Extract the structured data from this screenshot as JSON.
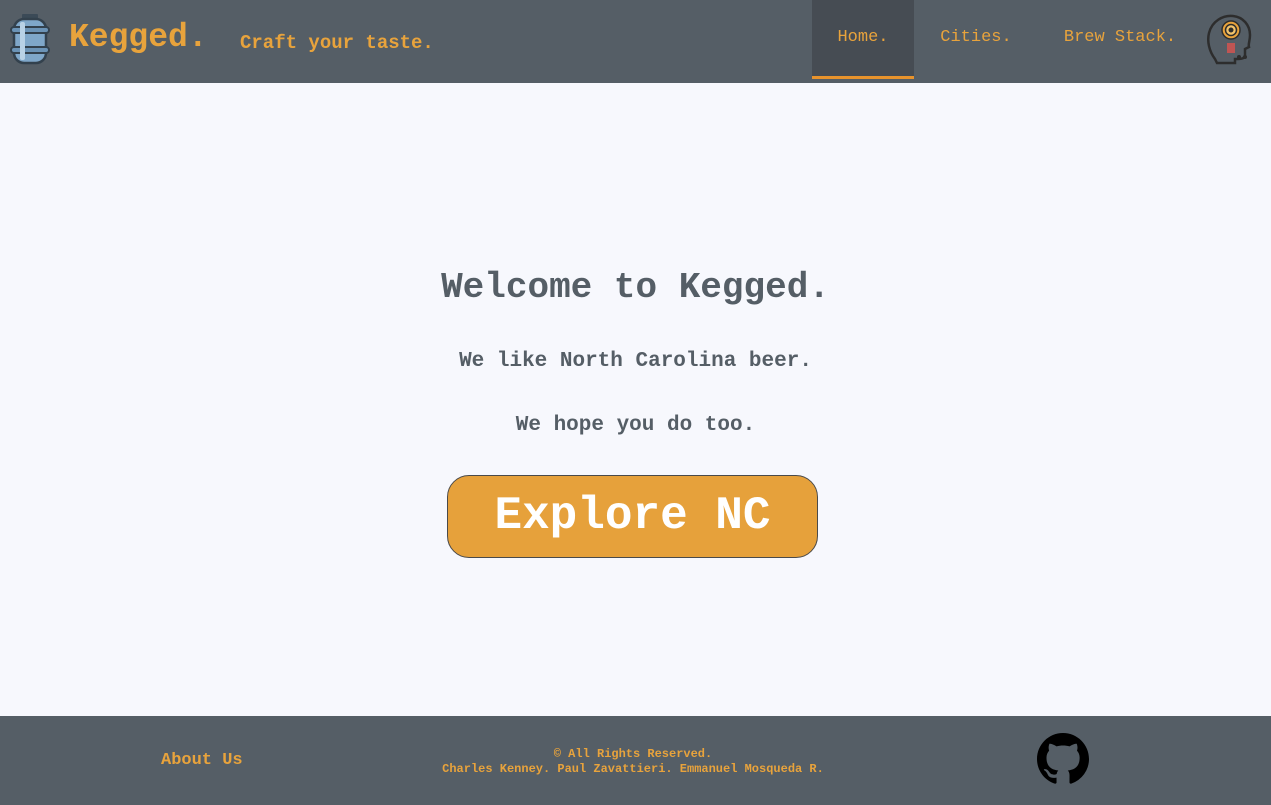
{
  "header": {
    "brand": "Kegged.",
    "tagline": "Craft your taste.",
    "logo_icon": "keg-icon",
    "profile_icon": "head-target-icon",
    "nav": [
      {
        "label": "Home.",
        "active": true
      },
      {
        "label": "Cities.",
        "active": false
      },
      {
        "label": "Brew Stack.",
        "active": false
      }
    ]
  },
  "hero": {
    "title": "Welcome to Kegged.",
    "line1": "We like North Carolina beer.",
    "line2": "We hope you do too.",
    "cta_label": "Explore NC"
  },
  "footer": {
    "about_label": "About Us",
    "copyright": "© All Rights Reserved.",
    "authors": "Charles Kenney. Paul Zavattieri. Emmanuel Mosqueda R.",
    "github_icon": "github-icon"
  },
  "colors": {
    "navbar_bg": "#555e66",
    "accent": "#e8a33c",
    "page_bg": "#f7f8fd",
    "cta_bg": "#e6a13b"
  }
}
